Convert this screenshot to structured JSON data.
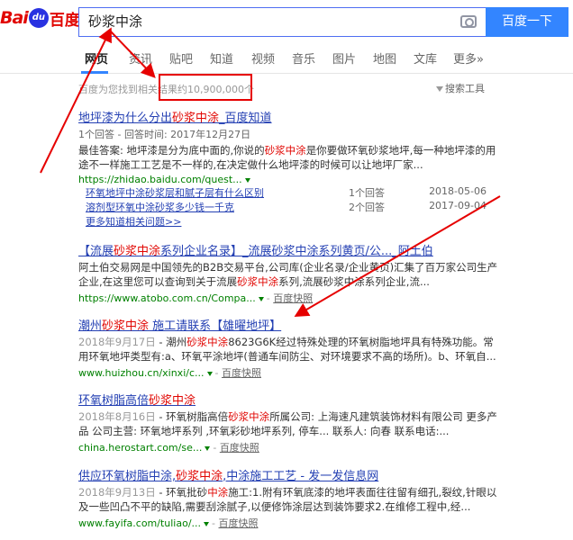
{
  "logo": {
    "bai": "Bai",
    "du": "du",
    "cn": "百度"
  },
  "search": {
    "query": "砂浆中涂",
    "button_label": "百度一下"
  },
  "tabs": [
    "网页",
    "资讯",
    "贴吧",
    "知道",
    "视频",
    "音乐",
    "图片",
    "地图",
    "文库",
    "更多»"
  ],
  "stats": {
    "text": "百度为您找到相关结果约10,900,000个",
    "tools_label": "搜索工具"
  },
  "results": [
    {
      "title_pre": "地坪漆为什么分出",
      "title_hl": "砂浆中涂",
      "title_post": "_百度知道",
      "meta": "1个回答 - 回答时间: 2017年12月27日",
      "abs_pre": "最佳答案: 地坪漆是分为底中面的,你说的",
      "abs_hl": "砂浆中涂",
      "abs_post": "是你要做环氧砂浆地坪,每一种地坪漆的用途不一样施工工艺是不一样的,在决定做什么地坪漆的时候可以让地坪厂家...",
      "url": "https://zhidao.baidu.com/quest...",
      "sub": [
        {
          "q": "环氧地坪中涂砂浆层和腻子层有什么区别",
          "n": "1个回答",
          "d": "2018-05-06"
        },
        {
          "q": "溶剂型环氧中涂砂浆多少钱一千克",
          "n": "2个回答",
          "d": "2017-09-04"
        }
      ],
      "more": "更多知道相关问题>>"
    },
    {
      "title_pre": "【流展",
      "title_hl": "砂浆中涂",
      "title_post": "系列企业名录】_流展砂浆中涂系列黄页/公..._阿土伯",
      "abs_pre": "阿土伯交易网是中国领先的B2B交易平台,公司库(企业名录/企业黄页)汇集了百万家公司生产企业,在这里您可以查询到关于流展",
      "abs_hl": "砂浆中涂",
      "abs_post": "系列,流展砂浆中涂系列企业,流...",
      "url": "https://www.atobo.com.cn/Compa...",
      "snap": "百度快照"
    },
    {
      "title_pre": "潮州",
      "title_hl": "砂浆中涂",
      "title_post": " 施工请联系【雄曜地坪】",
      "abs_date": "2018年9月17日",
      "abs_pre": " - 潮州",
      "abs_hl": "砂浆中涂",
      "abs_post": "8623G6K经过特殊处理的环氧树脂地坪具有特殊功能。常用环氧地坪类型有:a、环氧平涂地坪(普通车间防尘、对环境要求不高的场所)。b、环氧自...",
      "url": "www.huizhou.cn/xinxi/c...",
      "snap": "百度快照"
    },
    {
      "title_pre": "环氧树脂高倍",
      "title_hl": "砂浆中涂",
      "title_post": "",
      "abs_date": "2018年8月16日",
      "abs_pre": " - 环氧树脂高倍",
      "abs_hl": "砂浆中涂",
      "abs_post": "所属公司: 上海速凡建筑装饰材料有限公司 更多产品 公司主营: 环氧地坪系列 ,环氧彩砂地坪系列, 停车... 联系人: 向春 联系电话:...",
      "url": "china.herostart.com/se...",
      "snap": "百度快照"
    },
    {
      "title_pre": "供应环氧树脂中涂,",
      "title_hl": "砂浆中涂",
      "title_post": ",中涂施工工艺 - 发一发信息网",
      "abs_date": "2018年9月13日",
      "abs_pre": " - 环氧批砂",
      "abs_hl": "中涂",
      "abs_post": "施工:1.附有环氧底漆的地坪表面往往留有细孔,裂纹,针眼以及一些凹凸不平的缺陷,需要刮涂腻子,以便修饰涂层达到装饰要求2.在维修工程中,经...",
      "url": "www.fayifa.com/tuliao/...",
      "snap": "百度快照"
    }
  ],
  "colors": {
    "brand_blue": "#3385ff",
    "link": "#2440b3",
    "highlight": "#e10602",
    "url_green": "#008000",
    "annotation_red": "#e60000"
  }
}
